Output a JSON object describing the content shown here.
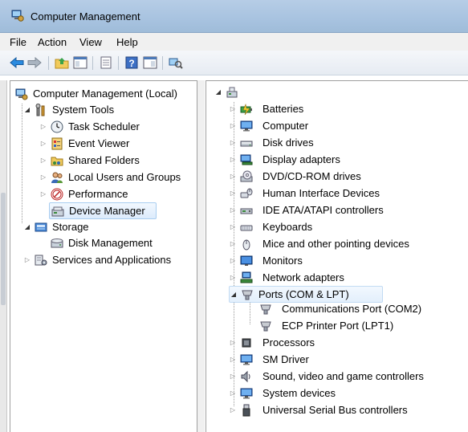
{
  "window": {
    "title": "Computer Management"
  },
  "menu": [
    "File",
    "Action",
    "View",
    "Help"
  ],
  "toolbar": {
    "buttons": [
      "back-icon",
      "forward-icon",
      "up-folder-icon",
      "show-hide-tree-icon",
      "export-list-icon",
      "help-icon",
      "show-action-pane-icon",
      "scan-hardware-icon"
    ]
  },
  "left_tree": {
    "root": "Computer Management (Local)",
    "system_tools": "System Tools",
    "task_scheduler": "Task Scheduler",
    "event_viewer": "Event Viewer",
    "shared_folders": "Shared Folders",
    "local_users": "Local Users and Groups",
    "performance": "Performance",
    "device_manager": "Device Manager",
    "storage": "Storage",
    "disk_management": "Disk Management",
    "services": "Services and Applications"
  },
  "devices": {
    "batteries": "Batteries",
    "computer": "Computer",
    "disk_drives": "Disk drives",
    "display_adapters": "Display adapters",
    "dvd": "DVD/CD-ROM drives",
    "hid": "Human Interface Devices",
    "ide": "IDE ATA/ATAPI controllers",
    "keyboards": "Keyboards",
    "mice": "Mice and other pointing devices",
    "monitors": "Monitors",
    "network": "Network adapters",
    "ports": "Ports (COM & LPT)",
    "com2": "Communications Port (COM2)",
    "lpt1": "ECP Printer Port (LPT1)",
    "processors": "Processors",
    "sm_driver": "SM Driver",
    "sound": "Sound, video and game controllers",
    "system_devices": "System devices",
    "usb": "Universal Serial Bus controllers"
  },
  "colors": {
    "titlebar": "#a8c3e0",
    "selection_border": "#a9cdf0",
    "selection_fill": "#dcebfc"
  }
}
